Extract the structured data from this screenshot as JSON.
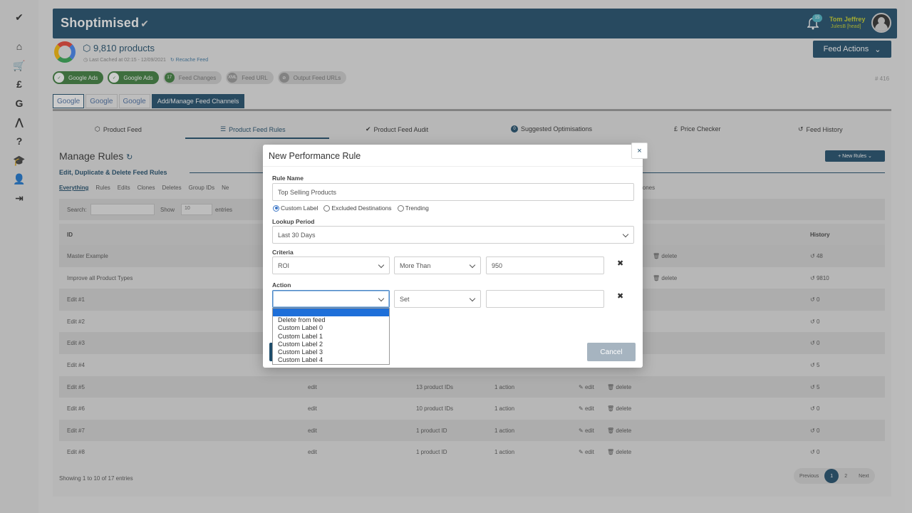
{
  "app": {
    "brand": "Shoptimised",
    "brand_mark": "✔",
    "user_name": "Tom Jeffrey",
    "user_sub": "JulesB [head]",
    "notifications": "15"
  },
  "rail": {
    "icons": [
      "logo-icon",
      "home-icon",
      "cart-icon",
      "pound-icon",
      "google-icon",
      "ads-icon",
      "help-icon",
      "graduation-icon",
      "user-icon",
      "logout-icon"
    ],
    "glyphs": [
      "✔",
      "⌂",
      "🛒",
      "£",
      "G",
      "⋀",
      "?",
      "🎓",
      "👤",
      "⇥"
    ]
  },
  "header": {
    "products": "9,810 products",
    "last_cached": "Last Cached at 02:15 - 12/09/2021",
    "recache": "Recache Feed",
    "feed_actions": "Feed Actions",
    "hash": "# 416"
  },
  "pills": [
    {
      "label": "Google Ads",
      "style": "green",
      "dot": "✓"
    },
    {
      "label": "Google Ads",
      "style": "green",
      "dot": "✓"
    },
    {
      "label": "Feed Changes",
      "style": "grey",
      "dot": "17"
    },
    {
      "label": "Feed URL",
      "style": "grey",
      "dot": "XML"
    },
    {
      "label": "Output Feed URLs",
      "style": "grey",
      "dot": "⊘"
    }
  ],
  "channel_tabs": [
    "Google",
    "Google",
    "Google",
    "Add/Manage Feed Channels"
  ],
  "sub_tabs": [
    {
      "label": "Product Feed",
      "icon": "⬡"
    },
    {
      "label": "Product Feed Rules",
      "icon": "☰"
    },
    {
      "label": "Product Feed Audit",
      "icon": "✔"
    },
    {
      "label": "Suggested Optimisations",
      "icon": "0"
    },
    {
      "label": "Price Checker",
      "icon": "£"
    },
    {
      "label": "Feed History",
      "icon": "↺"
    }
  ],
  "rules": {
    "title": "Manage Rules",
    "subtitle": "Edit, Duplicate & Delete Feed Rules",
    "new_rules": "+ New Rules",
    "filters": [
      "Everything",
      "Rules",
      "Edits",
      "Clones",
      "Deletes",
      "Group IDs",
      "Ne"
    ],
    "filters_tail": "lones",
    "search_label": "Search:",
    "show_label": "Show",
    "show_value": "10",
    "entries_label": "entries",
    "columns": {
      "id": "ID",
      "history": "History"
    },
    "rows": [
      {
        "id": "Master Example",
        "type": "",
        "target": "",
        "action": "",
        "edit": "",
        "delete": "delete",
        "history": "48"
      },
      {
        "id": "Improve all Product Types",
        "type": "",
        "target": "",
        "action": "",
        "edit": "",
        "delete": "delete",
        "history": "9810"
      },
      {
        "id": "Edit #1",
        "type": "",
        "target": "",
        "action": "",
        "edit": "",
        "delete": "",
        "history": "0"
      },
      {
        "id": "Edit #2",
        "type": "",
        "target": "",
        "action": "",
        "edit": "",
        "delete": "",
        "history": "0"
      },
      {
        "id": "Edit #3",
        "type": "",
        "target": "",
        "action": "",
        "edit": "",
        "delete": "",
        "history": "0"
      },
      {
        "id": "Edit #4",
        "type": "",
        "target": "",
        "action": "",
        "edit": "",
        "delete": "",
        "history": "5"
      },
      {
        "id": "Edit #5",
        "type": "edit",
        "target": "13 product IDs",
        "action": "1 action",
        "edit": "edit",
        "delete": "delete",
        "history": "5"
      },
      {
        "id": "Edit #6",
        "type": "edit",
        "target": "10 product IDs",
        "action": "1 action",
        "edit": "edit",
        "delete": "delete",
        "history": "0"
      },
      {
        "id": "Edit #7",
        "type": "edit",
        "target": "1 product ID",
        "action": "1 action",
        "edit": "edit",
        "delete": "delete",
        "history": "0"
      },
      {
        "id": "Edit #8",
        "type": "edit",
        "target": "1 product ID",
        "action": "1 action",
        "edit": "edit",
        "delete": "delete",
        "history": "0"
      }
    ],
    "showing": "Showing 1 to 10 of 17 entries",
    "pager": {
      "prev": "Previous",
      "p1": "1",
      "p2": "2",
      "next": "Next"
    }
  },
  "modal": {
    "title": "New Performance Rule",
    "close": "×",
    "rule_name_label": "Rule Name",
    "rule_name_value": "Top Selling Products",
    "radios": [
      {
        "label": "Custom Label",
        "checked": true
      },
      {
        "label": "Excluded Destinations",
        "checked": false
      },
      {
        "label": "Trending",
        "checked": false
      }
    ],
    "lookup_label": "Lookup Period",
    "lookup_value": "Last 30 Days",
    "criteria_label": "Criteria",
    "criteria_metric": "ROI",
    "criteria_op": "More Than",
    "criteria_value": "950",
    "action_label": "Action",
    "action_field": "",
    "action_op": "Set",
    "action_value": "",
    "remove": "✖",
    "cancel": "Cancel",
    "dropdown_options": [
      "",
      "Delete from feed",
      "Custom Label 0",
      "Custom Label 1",
      "Custom Label 2",
      "Custom Label 3",
      "Custom Label 4"
    ]
  }
}
